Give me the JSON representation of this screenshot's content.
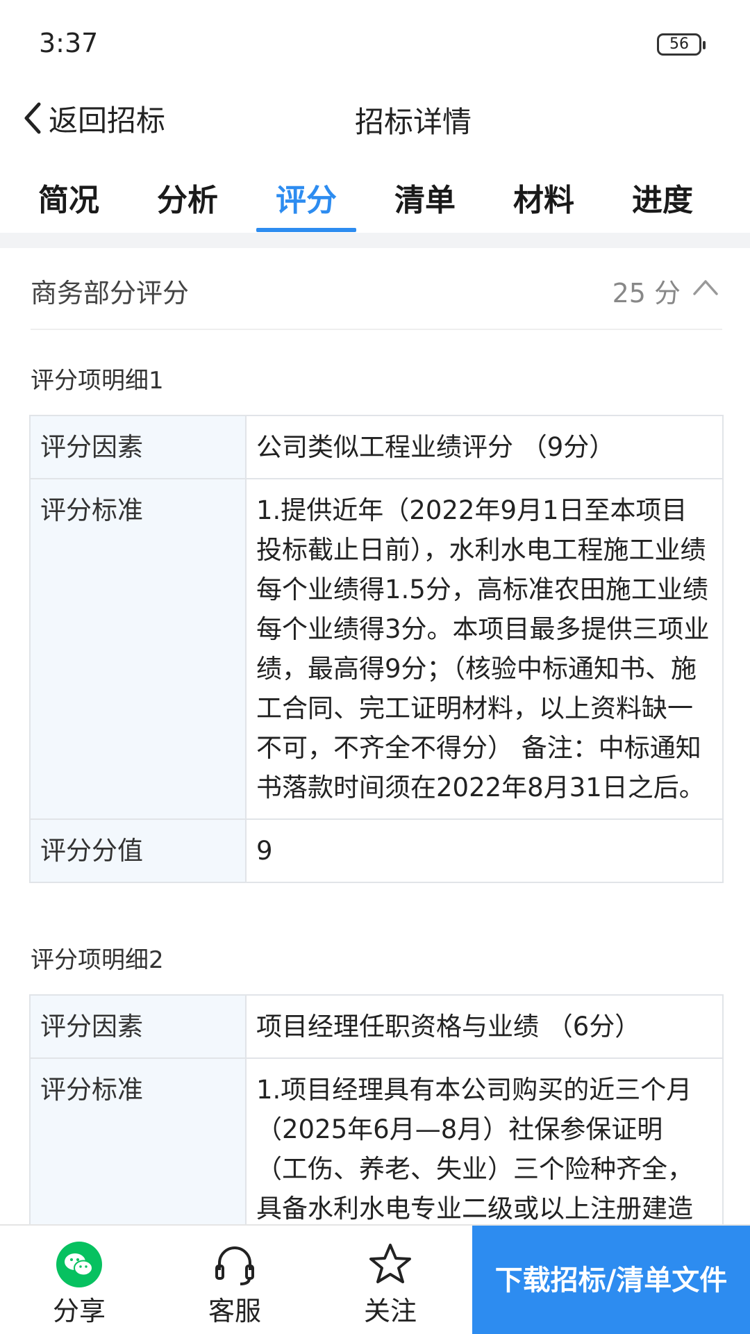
{
  "status_bar": {
    "time": "3:37",
    "battery": "56"
  },
  "nav": {
    "back_label": "返回招标",
    "title": "招标详情"
  },
  "tabs": [
    {
      "label": "简况"
    },
    {
      "label": "分析"
    },
    {
      "label": "评分"
    },
    {
      "label": "清单"
    },
    {
      "label": "材料"
    },
    {
      "label": "进度"
    }
  ],
  "active_tab": "评分",
  "section": {
    "title": "商务部分评分",
    "score": "25 分"
  },
  "details": [
    {
      "heading": "评分项明细1",
      "rows": [
        {
          "label": "评分因素",
          "value": "公司类似工程业绩评分 （9分）"
        },
        {
          "label": "评分标准",
          "value": "1.提供近年（2022年9月1日至本项目投标截止日前），水利水电工程施工业绩每个业绩得1.5分，高标准农田施工业绩每个业绩得3分。本项目最多提供三项业绩，最高得9分；（核验中标通知书、施工合同、完工证明材料，以上资料缺一不可，不齐全不得分） 备注：中标通知书落款时间须在2022年8月31日之后。"
        },
        {
          "label": "评分分值",
          "value": "9"
        }
      ]
    },
    {
      "heading": "评分项明细2",
      "rows": [
        {
          "label": "评分因素",
          "value": "项目经理任职资格与业绩 （6分）"
        },
        {
          "label": "评分标准",
          "value": "1.项目经理具有本公司购买的近三个月（2025年6月—8月）社保参保证明（工伤、养老、失业）三个险种齐全，具备水利水电专业二级或以上注册建造"
        }
      ]
    }
  ],
  "bottom_bar": {
    "share": "分享",
    "service": "客服",
    "follow": "关注",
    "download": "下载招标/清单文件"
  },
  "colors": {
    "accent": "#2d8cf0",
    "wechat_green": "#07c160",
    "label_bg": "#f3f8fd"
  }
}
